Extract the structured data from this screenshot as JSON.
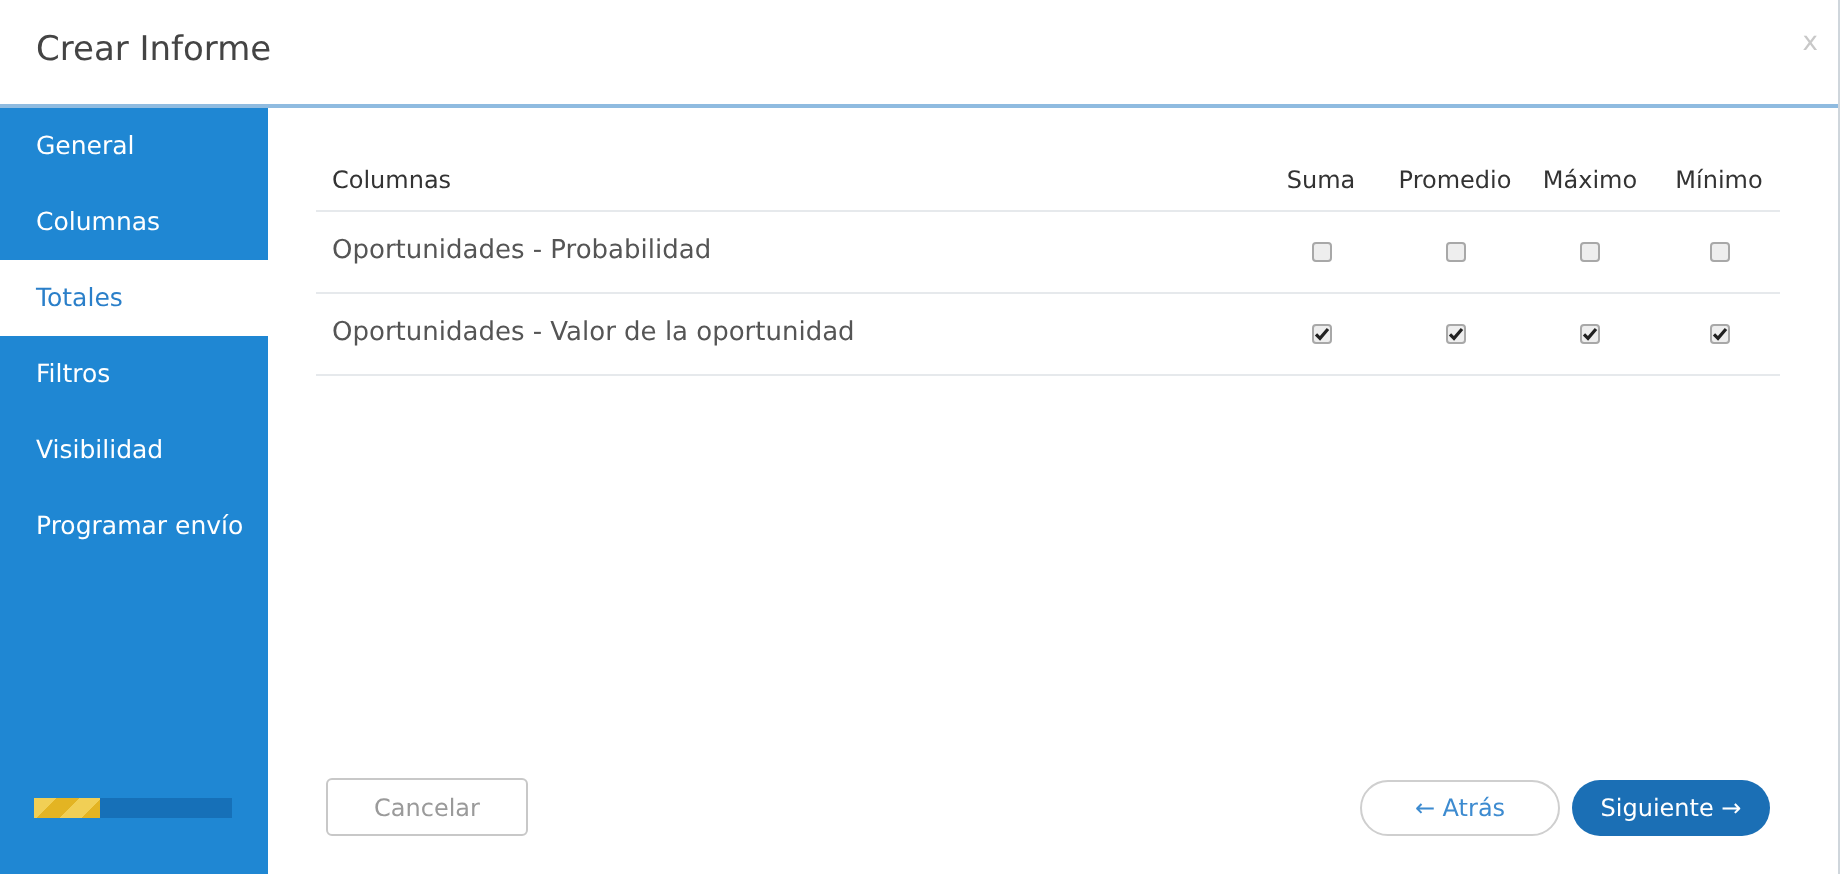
{
  "window": {
    "title": "Crear Informe",
    "close": "x"
  },
  "sidebar": {
    "items": [
      {
        "label": "General",
        "selected": false
      },
      {
        "label": "Columnas",
        "selected": false
      },
      {
        "label": "Totales",
        "selected": true
      },
      {
        "label": "Filtros",
        "selected": false
      },
      {
        "label": "Visibilidad",
        "selected": false
      },
      {
        "label": "Programar envío",
        "selected": false
      }
    ],
    "progress": {
      "level": 0.33
    }
  },
  "table": {
    "columns": [
      "Columnas",
      "Suma",
      "Promedio",
      "Máximo",
      "Mínimo"
    ],
    "rows": [
      {
        "name": "Oportunidades - Probabilidad",
        "checks": [
          {
            "checked": false
          },
          {
            "checked": false
          },
          {
            "checked": false
          },
          {
            "checked": false
          }
        ]
      },
      {
        "name": "Oportunidades - Valor de la oportunidad",
        "checks": [
          {
            "checked": true
          },
          {
            "checked": true
          },
          {
            "checked": true
          },
          {
            "checked": true
          }
        ]
      }
    ]
  },
  "buttons": {
    "cancel": "Cancelar",
    "back": "← Atrás",
    "next": "Siguiente →"
  }
}
